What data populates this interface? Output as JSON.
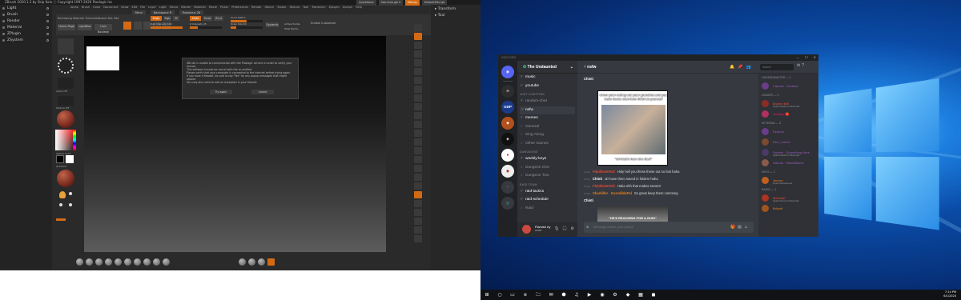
{
  "zbrush": {
    "title": "ZBrush 2020.1.3 by Skip Kaio ⓒ Copyright 1997-2020 Pixologic Inc",
    "title_right": "QuickSave   Menus   DefaultZScript",
    "menus": [
      "Alpha",
      "Brush",
      "Color",
      "Document",
      "Draw",
      "Edit",
      "File",
      "Layer",
      "Light",
      "Macro",
      "Marker",
      "Material",
      "Movie",
      "Picker",
      "Preferences",
      "Render",
      "Stencil",
      "Stroke",
      "Texture",
      "Tool",
      "Transform",
      "Zplugin",
      "Zscript",
      "Help"
    ],
    "menu_right": [
      "QuickSave",
      "See-through 0",
      "Menus",
      "DefaultZScript"
    ],
    "sub_items": [
      "Mrnn",
      "Backspace R",
      "Ramonus 28"
    ],
    "left_panel": [
      "Light",
      "Brush",
      "Render",
      "Material",
      "ZPlugin",
      "ZSystem"
    ],
    "home_tab": "Home Page",
    "lightbox_tab": "LightBox",
    "live_boolean": "Live Boolean",
    "notice": "Reviewing Material TransmitsBoard Net 9ite",
    "edit_label": "Edit",
    "draw_label": "Draw",
    "move_label": "Move",
    "scale_label": "Scale",
    "rotate_label": "Rotate",
    "mrgb_label": "Mrgb",
    "rgb_label": "Rgb",
    "m_label": "M",
    "zadd_label": "Zadd",
    "zsub_label": "Zsub",
    "zcut_label": "Zcut",
    "rgb_intensity": "Rgb Intensity 100",
    "z_intensity": "Z Intensity 25",
    "focal_shift": "Focal Shift 0",
    "draw_size": "Draw Size 64",
    "dynamic": "Dynamic",
    "active_points": "Active Points:",
    "total_points": "Total Points:",
    "enable_customize": "Enable Customize",
    "dialog_text": [
      "ZBrush is unable to communicate with the Pixologic servers in order to verify your license.",
      "This software license be cancel with the re-verified.",
      "Please verify that your computer is connected to the internet before trying again.",
      "If you have a firewall, be sure to tap \"Yes\" for any popup messages that might appear.",
      "You may also need to add an exception in your firewall."
    ],
    "dialog_try": "Try again",
    "dialog_cancel": "Cancel",
    "right_panel": [
      "Transform",
      "Tool"
    ],
    "left_labels": [
      "Alpha Off",
      "Texture Off",
      "Switch Color",
      "Gradient"
    ],
    "accent": "#d36a13"
  },
  "discord": {
    "title": "DISCORD",
    "window_controls": [
      "—",
      "☐",
      "✕"
    ],
    "server_name": "The Undaunted",
    "channel_title": "nsfw",
    "servers": [
      "GDP",
      "",
      "",
      "",
      ""
    ],
    "sections": [
      {
        "items": [
          {
            "name": "music",
            "type": "text",
            "bold": true
          },
          {
            "name": "youtube",
            "type": "text",
            "bold": true
          }
        ]
      },
      {
        "cat": "JUST CHATTING",
        "items": [
          {
            "name": "random-chat",
            "type": "text"
          },
          {
            "name": "nsfw",
            "type": "text",
            "sel": true
          },
          {
            "name": "memes",
            "type": "text",
            "bold": true
          },
          {
            "name": "General",
            "type": "voice"
          },
          {
            "name": "Sing Along",
            "type": "voice"
          },
          {
            "name": "Other Games",
            "type": "voice"
          }
        ]
      },
      {
        "cat": "DUNGEONS",
        "items": [
          {
            "name": "weekly-keys",
            "type": "text",
            "bold": true
          },
          {
            "name": "Dungeon One",
            "type": "voice"
          },
          {
            "name": "Dungeon Two",
            "type": "voice"
          }
        ]
      },
      {
        "cat": "RAID TEAM",
        "items": [
          {
            "name": "raid-tactics",
            "type": "text",
            "bold": true
          },
          {
            "name": "raid-schedule",
            "type": "text",
            "bold": true
          },
          {
            "name": "Raid",
            "type": "voice"
          }
        ]
      }
    ],
    "user": {
      "name": "Flamish ey",
      "tag": "#1069"
    },
    "messages": [
      {
        "author": "Chinti",
        "text": "",
        "color": "#fff"
      },
      {
        "author": "FluidOsterKid",
        "text": "Holy hell you threw these out so fast haha",
        "color": "#e74c3c",
        "time": "Today"
      },
      {
        "author": "Chinti",
        "text": "xD have them saved in folders haha",
        "color": "#fff",
        "time": "Today"
      },
      {
        "author": "FluidOsterKid",
        "text": "Haha ohh that makes sense!!",
        "color": "#e74c3c",
        "time": "Today"
      },
      {
        "author": "Sharkiller · IncrediblePal",
        "text": "So great keep them comming",
        "color": "#e67e22",
        "time": "Today"
      },
      {
        "author": "Chinti",
        "text": "",
        "color": "#fff"
      }
    ],
    "meme_top": "when your eating out your grandma and you taste horse cum then think to yourself",
    "meme_bottom": "\"oh that's how she died\"",
    "meme2_text": "\"HE'S REACHING FOR A GUN!\"",
    "input_placeholder": "Message #nsfw, your phone",
    "search_placeholder": "Search",
    "member_groups": [
      {
        "cat": "UNDEADMASTER — 1",
        "members": [
          {
            "name": "Captain · Undead",
            "color": "#9b59b6",
            "av": "#6a3d8a"
          }
        ]
      },
      {
        "cat": "LEADER — 2",
        "members": [
          {
            "name": "Broken Mill",
            "sub": "Sparkl Medal of Mancraft",
            "color": "#e74c3c",
            "av": "#8b2d24"
          },
          {
            "name": "JustBop 🔴",
            "color": "#e91e63",
            "av": "#b03060"
          }
        ]
      },
      {
        "cat": "VETERAN — 3",
        "members": [
          {
            "name": "Dealuto",
            "color": "#9b59b6",
            "av": "#6a3d8a"
          },
          {
            "name": "Red_Lolzed",
            "color": "#9b59b6",
            "av": "#7a4a30"
          },
          {
            "name": "Swerve · Something Here",
            "sub": "Sparkl Medal of Mancraft",
            "color": "#9b59b6",
            "av": "#4a3a6a"
          },
          {
            "name": "Natrula · Sinkwillanes",
            "color": "#9b59b6",
            "av": "#8a5a4a"
          }
        ]
      },
      {
        "cat": "DEVS — 1",
        "members": [
          {
            "name": "Jeeves",
            "sub": "Sparkl Elvestreets",
            "color": "#e67e22",
            "av": "#c06020"
          }
        ]
      },
      {
        "cat": "RAIDS — 1",
        "members": [
          {
            "name": "MarkeyK",
            "sub": "Sparkl Word of Mancraft",
            "color": "#e74c3c",
            "av": "#aa3322"
          },
          {
            "name": "Britsoft",
            "color": "#e67e22",
            "av": "#a05520"
          }
        ]
      }
    ]
  },
  "taskbar": {
    "time": "7:14 PM",
    "date": "6/1/2020",
    "icons": [
      "⊞",
      "○",
      "▭",
      "e",
      "🗀",
      "✉",
      "⬢",
      "♫",
      "▶",
      "◉",
      "⚙",
      "◆",
      "▦",
      "◼"
    ]
  }
}
